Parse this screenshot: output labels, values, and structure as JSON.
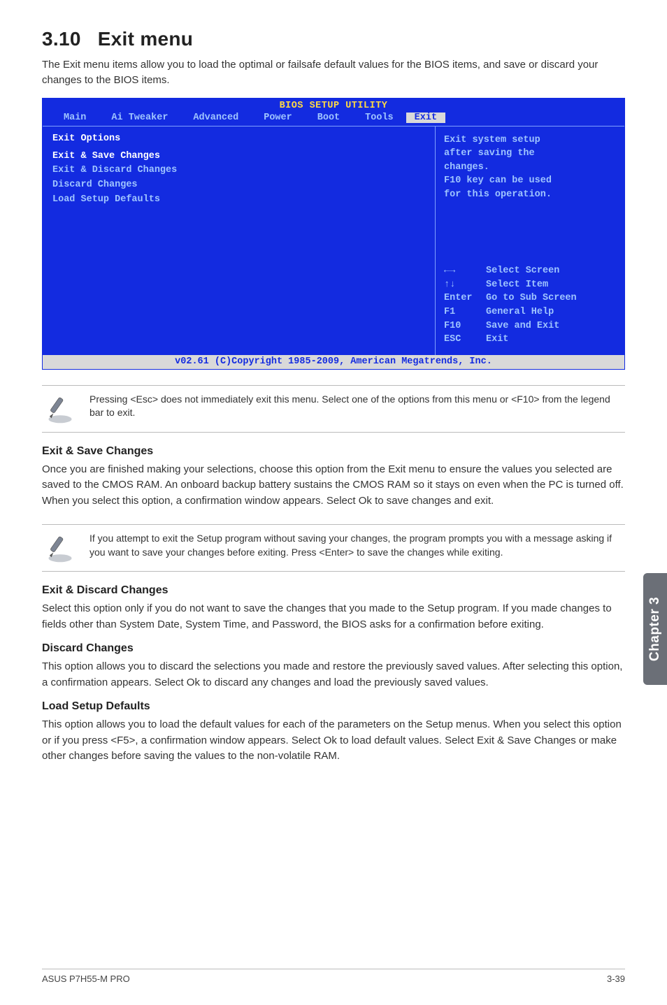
{
  "section": {
    "number": "3.10",
    "title": "Exit menu"
  },
  "intro": "The Exit menu items allow you to load the optimal or failsafe default values for the BIOS items, and save or discard your changes to the BIOS items.",
  "bios": {
    "title": "BIOS SETUP UTILITY",
    "tabs": [
      "Main",
      "Ai Tweaker",
      "Advanced",
      "Power",
      "Boot",
      "Tools",
      "Exit"
    ],
    "active_tab": "Exit",
    "left_heading": "Exit Options",
    "options": [
      "Exit & Save Changes",
      "Exit & Discard Changes",
      "Discard Changes",
      "",
      "Load Setup Defaults"
    ],
    "help_lines": [
      "Exit system setup",
      "after saving the",
      "changes.",
      "",
      "F10 key can be used",
      "for this operation."
    ],
    "legend": [
      {
        "key": "←→",
        "label": "Select Screen"
      },
      {
        "key": "↑↓",
        "label": "Select Item"
      },
      {
        "key": "Enter",
        "label": "Go to Sub Screen"
      },
      {
        "key": "F1",
        "label": "General Help"
      },
      {
        "key": "F10",
        "label": "Save and Exit"
      },
      {
        "key": "ESC",
        "label": "Exit"
      }
    ],
    "copyright": "v02.61 (C)Copyright 1985-2009, American Megatrends, Inc."
  },
  "note1": "Pressing <Esc> does not immediately exit this menu. Select one of the options from this menu or <F10> from the legend bar to exit.",
  "sub1": {
    "title": "Exit & Save Changes",
    "body": "Once you are finished making your selections, choose this option from the Exit menu to ensure the values you selected are saved to the CMOS RAM. An onboard backup battery sustains the CMOS RAM so it stays on even when the PC is turned off. When you select this option, a confirmation window appears. Select Ok to save changes and exit."
  },
  "note2": "If you attempt to exit the Setup program without saving your changes, the program prompts you with a message asking if you want to save your changes before exiting. Press <Enter> to save the changes while exiting.",
  "sub2": {
    "title": "Exit & Discard Changes",
    "body": "Select this option only if you do not want to save the changes that you made to the Setup program. If you made changes to fields other than System Date, System Time, and Password, the BIOS asks for a confirmation before exiting."
  },
  "sub3": {
    "title": "Discard Changes",
    "body": "This option allows you to discard the selections you made and restore the previously saved values. After selecting this option, a confirmation appears. Select Ok to discard any changes and load the previously saved values."
  },
  "sub4": {
    "title": "Load Setup Defaults",
    "body": "This option allows you to load the default values for each of the parameters on the Setup menus. When you select this option or if you press <F5>, a confirmation window appears. Select Ok to load default values. Select Exit & Save Changes or make other changes before saving the values to the non-volatile RAM."
  },
  "chapter_tab": "Chapter 3",
  "footer": {
    "left": "ASUS P7H55-M PRO",
    "right": "3-39"
  }
}
